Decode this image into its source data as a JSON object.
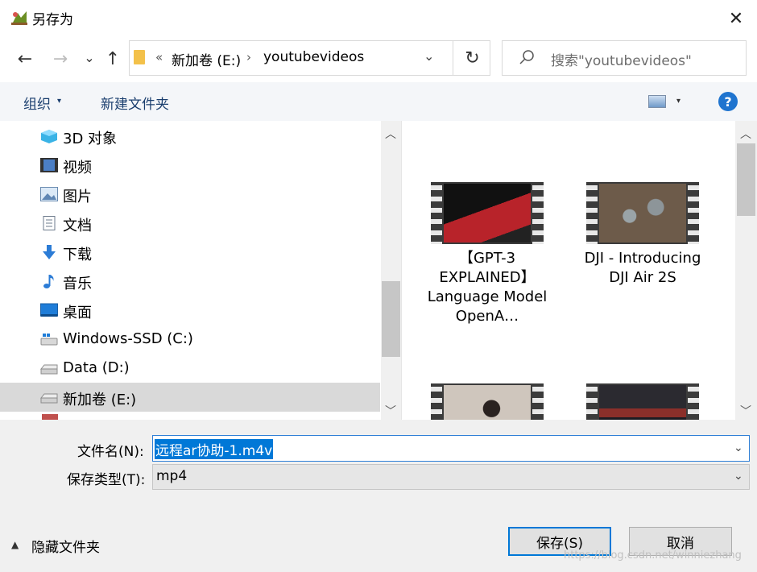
{
  "window": {
    "title": "另存为",
    "close_glyph": "✕"
  },
  "nav": {
    "back_glyph": "←",
    "forward_glyph": "→",
    "recent_glyph": "⌄",
    "up_glyph": "↑",
    "address": {
      "chevrons": "«",
      "drive": "新加卷 (E:)",
      "separator": "›",
      "folder": "youtubevideos",
      "dropdown_glyph": "⌄"
    },
    "refresh_glyph": "↻",
    "search_placeholder": "搜索\"youtubevideos\""
  },
  "toolbar": {
    "organize": "组织",
    "caret": "▾",
    "new_folder": "新建文件夹",
    "help": "?"
  },
  "tree": [
    {
      "label": "3D 对象",
      "icon": "3d-objects-icon"
    },
    {
      "label": "视频",
      "icon": "videos-icon"
    },
    {
      "label": "图片",
      "icon": "pictures-icon"
    },
    {
      "label": "文档",
      "icon": "documents-icon"
    },
    {
      "label": "下载",
      "icon": "downloads-icon"
    },
    {
      "label": "音乐",
      "icon": "music-icon"
    },
    {
      "label": "桌面",
      "icon": "desktop-icon"
    },
    {
      "label": "Windows-SSD (C:)",
      "icon": "drive-icon"
    },
    {
      "label": "Data (D:)",
      "icon": "drive-icon"
    },
    {
      "label": "新加卷 (E:)",
      "icon": "drive-icon"
    }
  ],
  "scroll": {
    "up": "︿",
    "down": "﹀"
  },
  "files": [
    {
      "name": "【GPT-3 EXPLAINED】Language Model OpenA…",
      "thumb_color": "#b8232a"
    },
    {
      "name": "DJI - Introducing DJI Air 2S",
      "thumb_color": "#6d5b4a"
    },
    {
      "name": "",
      "thumb_color": "#9a8f86"
    },
    {
      "name": "",
      "thumb_color": "#2b2a30"
    }
  ],
  "bottom": {
    "filename_label": "文件名(N):",
    "filename_value": "远程ar协助-1.m4v",
    "filetype_label": "保存类型(T):",
    "filetype_value": "mp4",
    "dropdown_glyph": "⌄",
    "hide_folders_caret": "▲",
    "hide_folders": "隐藏文件夹",
    "save": "保存(S)",
    "cancel": "取消",
    "watermark": "https://blog.csdn.net/winniezhang"
  },
  "colors": {
    "accent": "#0078d7",
    "selection": "#d9d9d9",
    "toolbar_bg": "#f4f6f9"
  }
}
